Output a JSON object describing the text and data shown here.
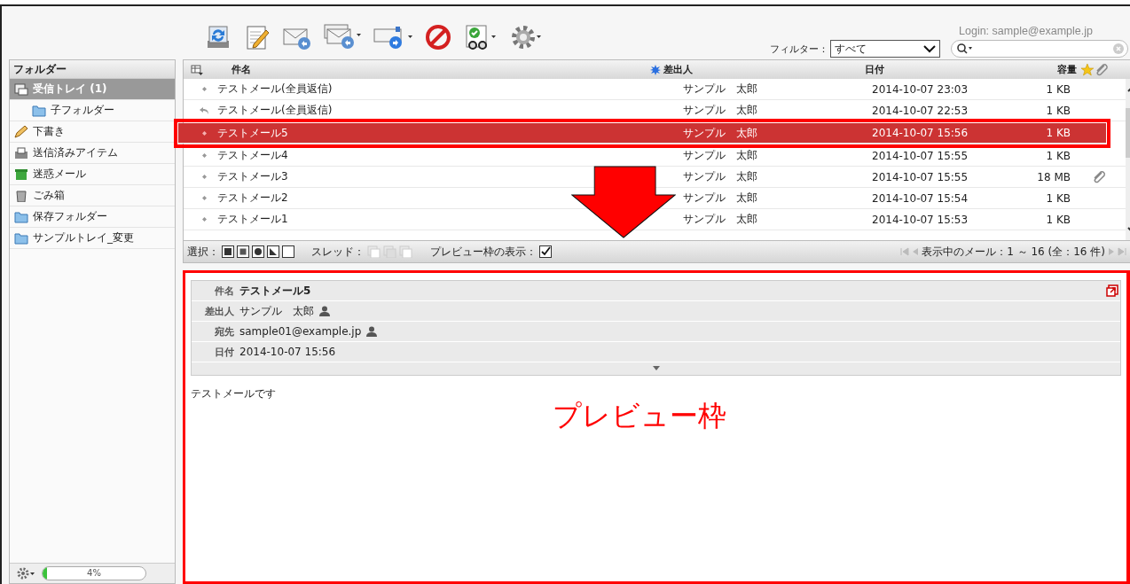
{
  "header": {
    "login": "Login: sample@example.jp",
    "filter_label": "フィルター：",
    "filter_value": "すべて"
  },
  "sidebar": {
    "title": "フォルダー",
    "folders": [
      {
        "kind": "inbox",
        "label": "受信トレイ (1)",
        "selected": true,
        "children": [
          {
            "kind": "folder",
            "label": "子フォルダー",
            "selected": false
          }
        ]
      },
      {
        "kind": "draft",
        "label": "下書き",
        "selected": false
      },
      {
        "kind": "sent",
        "label": "送信済みアイテム",
        "selected": false
      },
      {
        "kind": "spam",
        "label": "迷惑メール",
        "selected": false
      },
      {
        "kind": "trash",
        "label": "ごみ箱",
        "selected": false
      },
      {
        "kind": "folder",
        "label": "保存フォルダー",
        "selected": false
      },
      {
        "kind": "folder",
        "label": "サンプルトレイ_変更",
        "selected": false
      }
    ],
    "quota": {
      "reading": "4%",
      "level": 0.04
    }
  },
  "message_list": {
    "columns": [
      "件名",
      "差出人",
      "日付",
      "容量"
    ],
    "rows": [
      {
        "kind": "normal",
        "subject": "テストメール(全員返信)",
        "sender": "サンプル　太郎",
        "date": "2014-10-07 23:03",
        "size": "1 KB",
        "attachment": false,
        "selected": false
      },
      {
        "kind": "replied",
        "subject": "テストメール(全員返信)",
        "sender": "サンプル　太郎",
        "date": "2014-10-07 22:53",
        "size": "1 KB",
        "attachment": false,
        "selected": false
      },
      {
        "kind": "normal",
        "subject": "テストメール5",
        "sender": "サンプル　太郎",
        "date": "2014-10-07 15:56",
        "size": "1 KB",
        "attachment": false,
        "selected": true
      },
      {
        "kind": "normal",
        "subject": "テストメール4",
        "sender": "サンプル　太郎",
        "date": "2014-10-07 15:55",
        "size": "1 KB",
        "attachment": false,
        "selected": false
      },
      {
        "kind": "normal",
        "subject": "テストメール3",
        "sender": "サンプル　太郎",
        "date": "2014-10-07 15:55",
        "size": "18 MB",
        "attachment": true,
        "selected": false
      },
      {
        "kind": "normal",
        "subject": "テストメール2",
        "sender": "サンプル　太郎",
        "date": "2014-10-07 15:54",
        "size": "1 KB",
        "attachment": false,
        "selected": false
      },
      {
        "kind": "normal",
        "subject": "テストメール1",
        "sender": "サンプル　太郎",
        "date": "2014-10-07 15:53",
        "size": "1 KB",
        "attachment": false,
        "selected": false
      }
    ],
    "select_label": "選択：",
    "thread_label": "スレッド：",
    "preview_toggle": {
      "label": "プレビュー枠の表示：",
      "checked": true
    },
    "paging": "表示中のメール：1 ～ 16 (全：16 件)"
  },
  "preview": {
    "fields": [
      {
        "kind": "subject",
        "label": "件名",
        "value": "テストメール5"
      },
      {
        "kind": "person",
        "label": "差出人",
        "value": "サンプル　太郎"
      },
      {
        "kind": "person",
        "label": "宛先",
        "value": "sample01@example.jp"
      },
      {
        "kind": "plain",
        "label": "日付",
        "value": "2014-10-07 15:56"
      }
    ],
    "body": "テストメールです"
  },
  "annotation": {
    "label": "プレビュー枠"
  }
}
